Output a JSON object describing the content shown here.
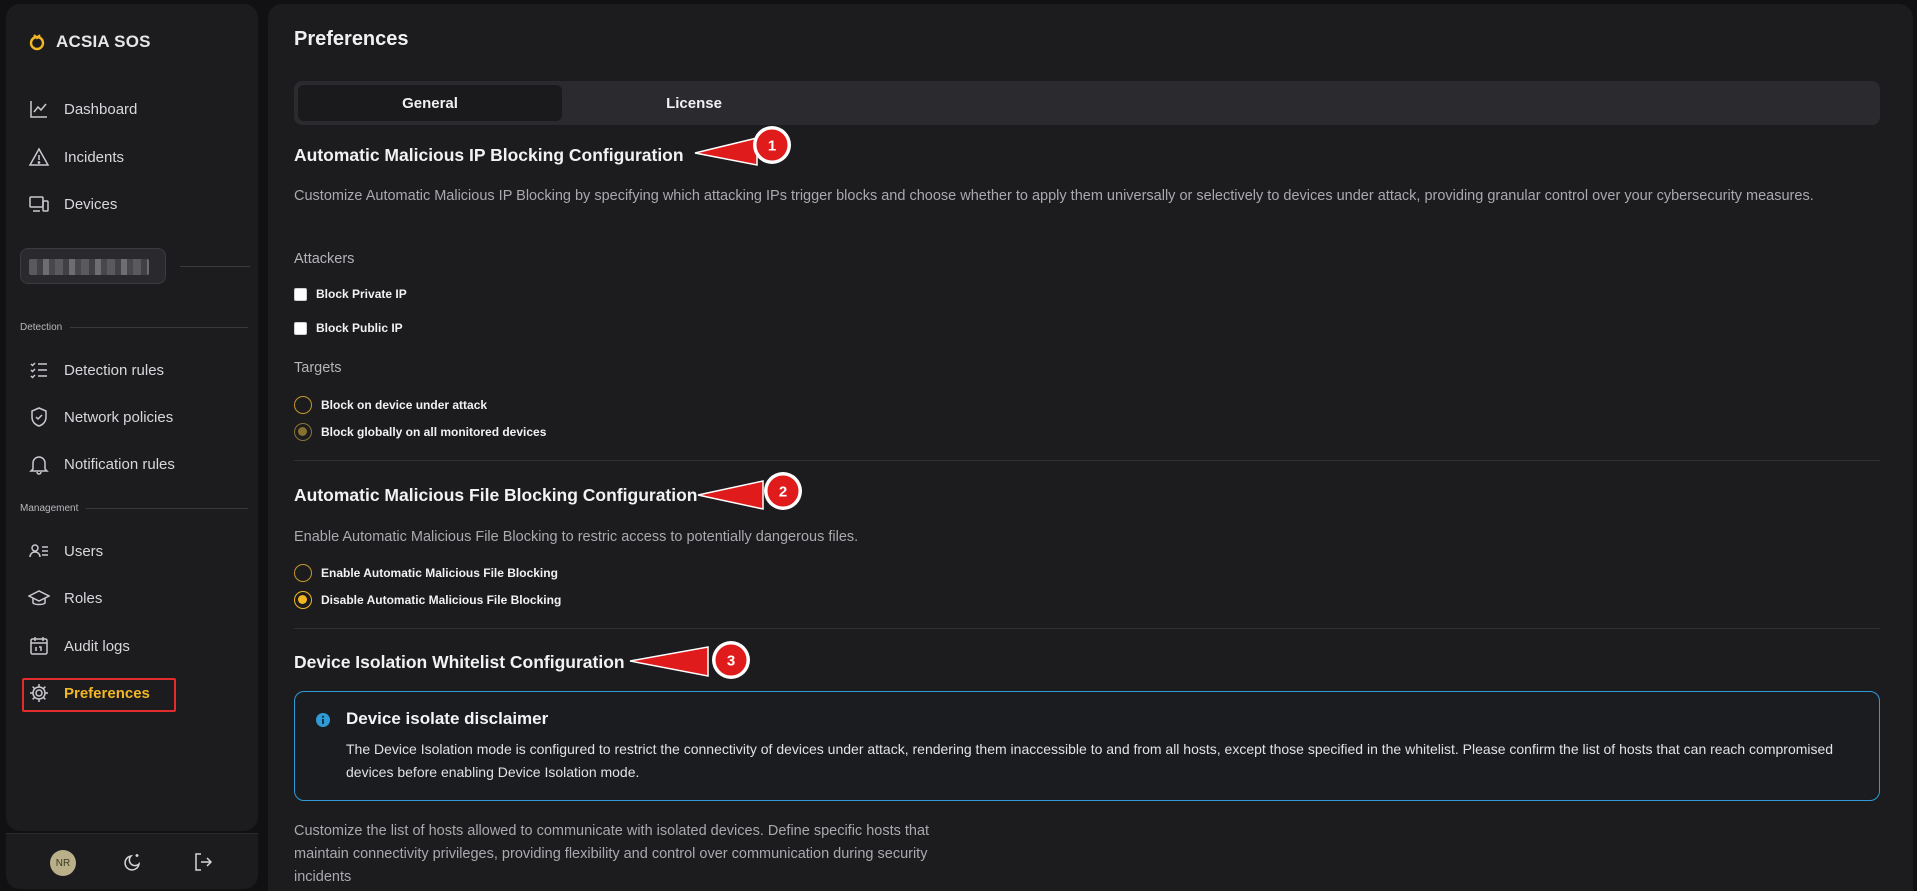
{
  "app": {
    "name": "ACSIA SOS"
  },
  "sidebar": {
    "primary": [
      {
        "label": "Dashboard",
        "icon": "chart-line-icon"
      },
      {
        "label": "Incidents",
        "icon": "warning-triangle-icon"
      },
      {
        "label": "Devices",
        "icon": "devices-icon"
      }
    ],
    "detection_label": "Detection",
    "detection": [
      {
        "label": "Detection rules",
        "icon": "checklist-icon"
      },
      {
        "label": "Network policies",
        "icon": "shield-check-icon"
      },
      {
        "label": "Notification rules",
        "icon": "bell-icon"
      }
    ],
    "management_label": "Management",
    "management": [
      {
        "label": "Users",
        "icon": "users-list-icon"
      },
      {
        "label": "Roles",
        "icon": "graduation-cap-icon"
      },
      {
        "label": "Audit logs",
        "icon": "calendar-icon"
      },
      {
        "label": "Preferences",
        "icon": "gear-icon",
        "active": true
      }
    ],
    "footer": {
      "avatar_initials": "NR"
    }
  },
  "main": {
    "title": "Preferences",
    "tabs": [
      {
        "label": "General",
        "active": true
      },
      {
        "label": "License",
        "active": false
      }
    ],
    "ip_blocking": {
      "heading": "Automatic Malicious IP Blocking Configuration",
      "description": "Customize Automatic Malicious IP Blocking by specifying which attacking IPs trigger blocks and choose whether to apply them universally or selectively to devices under attack, providing granular control over your cybersecurity measures.",
      "attackers_label": "Attackers",
      "block_private": "Block Private IP",
      "block_public": "Block Public IP",
      "targets_label": "Targets",
      "target_device": "Block on device under attack",
      "target_global": "Block globally on all monitored devices",
      "selected_target": "Block globally on all monitored devices"
    },
    "file_blocking": {
      "heading": "Automatic Malicious File Blocking Configuration",
      "description": "Enable Automatic Malicious File Blocking to restric access to potentially dangerous files.",
      "enable": "Enable Automatic Malicious File Blocking",
      "disable": "Disable Automatic Malicious File Blocking",
      "selected": "Disable Automatic Malicious File Blocking"
    },
    "isolation": {
      "heading": "Device Isolation Whitelist Configuration",
      "disclaimer_title": "Device isolate disclaimer",
      "disclaimer_text": "The Device Isolation mode is configured to restrict the connectivity of devices under attack, rendering them inaccessible to and from all hosts, except those specified in the whitelist. Please confirm the list of hosts that can reach compromised devices before enabling Device Isolation mode.",
      "description": "Customize the list of hosts allowed to communicate with isolated devices. Define specific hosts that maintain connectivity privileges, providing flexibility and control over communication during security incidents"
    }
  },
  "annotations": {
    "callouts": [
      "1",
      "2",
      "3"
    ]
  },
  "colors": {
    "accent": "#f3b624",
    "callout": "#e01b1b",
    "info": "#2e9bd6"
  }
}
